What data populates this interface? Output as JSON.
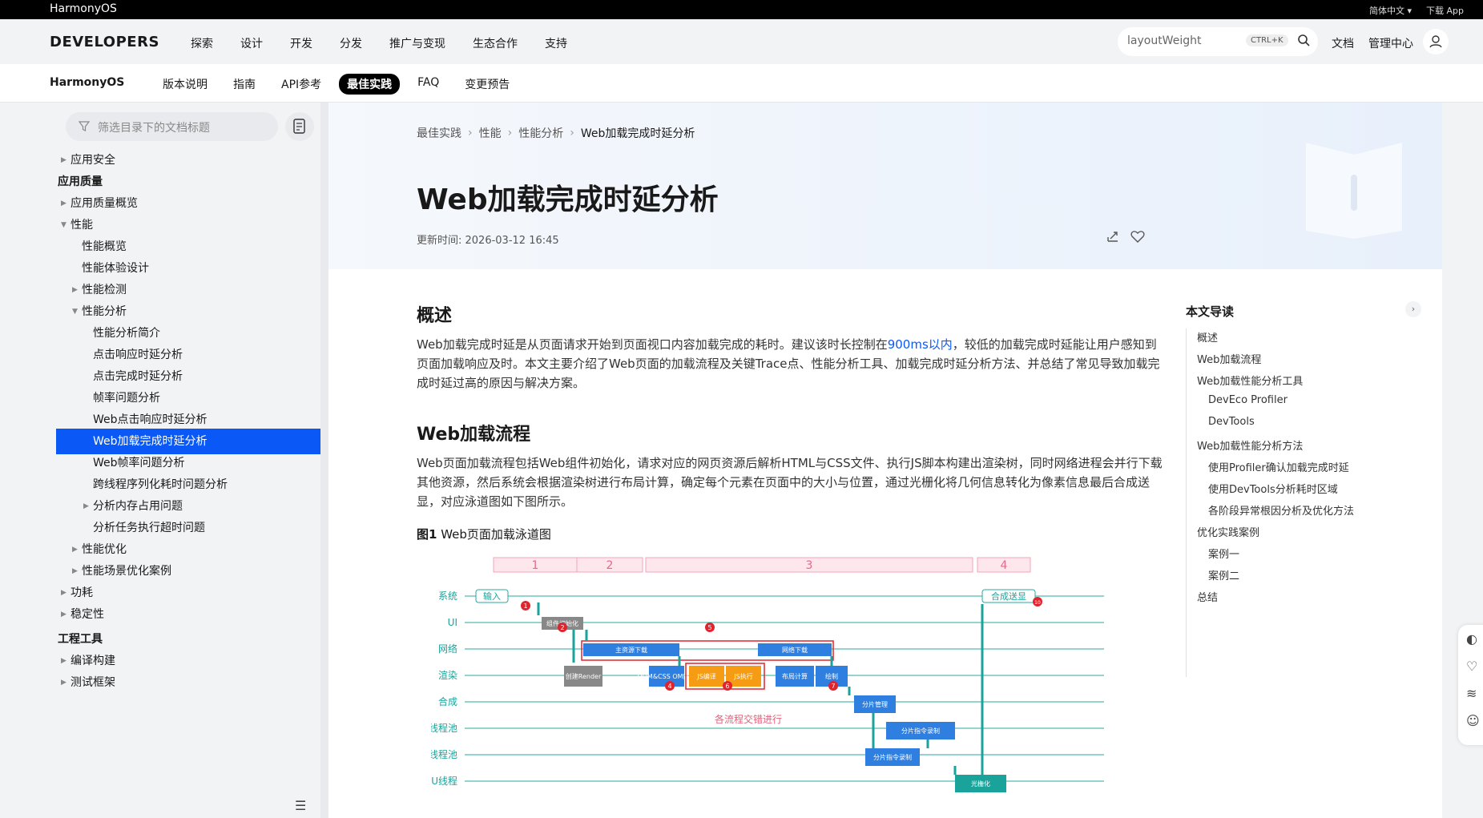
{
  "topbar": {
    "brand": "HarmonyOS",
    "lang": "简体中文 ▾",
    "download": "下载 App"
  },
  "mainnav": {
    "logo": "DEVELOPERS",
    "items": [
      "探索",
      "设计",
      "开发",
      "分发",
      "推广与变现",
      "生态合作",
      "支持"
    ],
    "search_value": "layoutWeight",
    "search_kbd": "CTRL+K",
    "docs": "文档",
    "console": "管理中心"
  },
  "subnav": {
    "product": "HarmonyOS",
    "tabs": [
      "版本说明",
      "指南",
      "API参考",
      "最佳实践",
      "FAQ",
      "变更预告"
    ],
    "active_tab": "最佳实践"
  },
  "sidebar": {
    "filter_placeholder": "筛选目录下的文档标题",
    "items": [
      {
        "label": "应用安全",
        "level": 0,
        "caret": "right"
      },
      {
        "label": "应用质量",
        "level": 0,
        "group": true
      },
      {
        "label": "应用质量概览",
        "level": 0,
        "caret": "right"
      },
      {
        "label": "性能",
        "level": 0,
        "caret": "down"
      },
      {
        "label": "性能概览",
        "level": 1
      },
      {
        "label": "性能体验设计",
        "level": 1
      },
      {
        "label": "性能检测",
        "level": 1,
        "caret": "right"
      },
      {
        "label": "性能分析",
        "level": 1,
        "caret": "down"
      },
      {
        "label": "性能分析简介",
        "level": 2
      },
      {
        "label": "点击响应时延分析",
        "level": 2
      },
      {
        "label": "点击完成时延分析",
        "level": 2
      },
      {
        "label": "帧率问题分析",
        "level": 2
      },
      {
        "label": "Web点击响应时延分析",
        "level": 2
      },
      {
        "label": "Web加载完成时延分析",
        "level": 2,
        "active": true
      },
      {
        "label": "Web帧率问题分析",
        "level": 2
      },
      {
        "label": "跨线程序列化耗时问题分析",
        "level": 2
      },
      {
        "label": "分析内存占用问题",
        "level": 2,
        "caret": "right"
      },
      {
        "label": "分析任务执行超时问题",
        "level": 2
      },
      {
        "label": "性能优化",
        "level": 1,
        "caret": "right"
      },
      {
        "label": "性能场景优化案例",
        "level": 1,
        "caret": "right"
      },
      {
        "label": "功耗",
        "level": 0,
        "caret": "right"
      },
      {
        "label": "稳定性",
        "level": 0,
        "caret": "right"
      },
      {
        "label": "工程工具",
        "level": 0,
        "group": true
      },
      {
        "label": "编译构建",
        "level": 0,
        "caret": "right"
      },
      {
        "label": "测试框架",
        "level": 0,
        "caret": "right"
      }
    ]
  },
  "article": {
    "breadcrumb": [
      "最佳实践",
      "性能",
      "性能分析",
      "Web加载完成时延分析"
    ],
    "title": "Web加载完成时延分析",
    "updated": "更新时间: 2026-03-12 16:45",
    "overview_heading": "概述",
    "overview_p1a": "Web加载完成时延是从页面请求开始到页面视口内容加载完成的耗时。建议该时长控制在",
    "overview_link": "900ms以内",
    "overview_p1b": "，较低的加载完成时延能让用户感知到页面加载响应及时。本文主要介绍了Web页面的加载流程及关键Trace点、性能分析工具、加载完成时延分析方法、并总结了常见导致加载完成时延过高的原因与解决方案。",
    "flow_heading": "Web加载流程",
    "flow_p": "Web页面加载流程包括Web组件初始化，请求对应的网页资源后解析HTML与CSS文件、执行JS脚本构建出渲染树，同时网络进程会并行下载其他资源，然后系统会根据渲染树进行布局计算，确定每个元素在页面中的大小与位置，通过光栅化将几何信息转化为像素信息最后合成送显，对应泳道图如下图所示。",
    "figure_label": "图1",
    "figure_caption": "Web页面加载泳道图"
  },
  "diagram": {
    "phases": [
      "1",
      "2",
      "3",
      "4"
    ],
    "lanes": [
      "系统",
      "UI",
      "网络",
      "渲染",
      "合成",
      "线程池",
      "线程池",
      "GPU线程"
    ],
    "boxes": {
      "input": "输入",
      "present": "合成送显",
      "init": "组件初始化",
      "main_dl": "主资源下载",
      "net_dl": "网络下载",
      "create_render": "创建Render",
      "dom": "DOM&CSS OM解析",
      "js_compile": "JS编译",
      "js_exec": "JS执行",
      "layout": "布局计算",
      "paint": "绘制",
      "tile": "分片管理",
      "raster1": "分片指令录制",
      "raster2": "分片指令录制",
      "raster_gpu": "光栅化"
    },
    "interleave": "各流程交错进行",
    "markers": [
      "1",
      "2",
      "4",
      "5",
      "6",
      "7",
      "10"
    ]
  },
  "toc": {
    "heading": "本文导读",
    "items": [
      {
        "label": "概述",
        "level": 0
      },
      {
        "label": "Web加载流程",
        "level": 0
      },
      {
        "label": "Web加载性能分析工具",
        "level": 0
      },
      {
        "label": "DevEco Profiler",
        "level": 1
      },
      {
        "label": "DevTools",
        "level": 1
      },
      {
        "label": "Web加载性能分析方法",
        "level": 0
      },
      {
        "label": "使用Profiler确认加载完成时延",
        "level": 1
      },
      {
        "label": "使用DevTools分析耗时区域",
        "level": 1
      },
      {
        "label": "各阶段异常根因分析及优化方法",
        "level": 1
      },
      {
        "label": "优化实践案例",
        "level": 0
      },
      {
        "label": "案例一",
        "level": 1
      },
      {
        "label": "案例二",
        "level": 1
      },
      {
        "label": "总结",
        "level": 0
      }
    ]
  }
}
